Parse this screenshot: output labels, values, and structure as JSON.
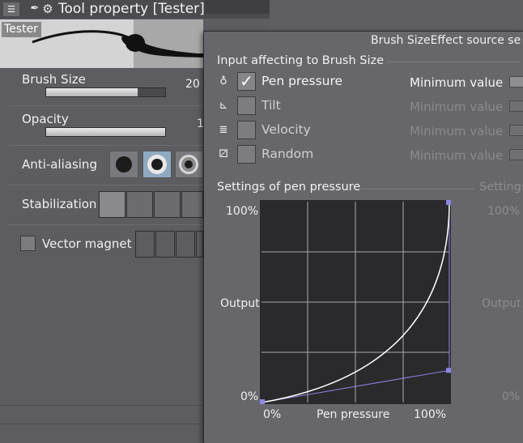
{
  "tool_property": {
    "title": "Tool property [Tester]",
    "menu_icon": "menu-icon",
    "tool_icon": "pen-nib-icon",
    "settings_icon": "gear-icon",
    "preview_label": "Tester",
    "brush_size": {
      "label": "Brush Size",
      "value": "20",
      "fill_fraction": 0.77
    },
    "opacity": {
      "label": "Opacity",
      "value": "1",
      "fill_fraction": 1.0
    },
    "anti_aliasing": {
      "label": "Anti-aliasing",
      "selected_index": 1
    },
    "stabilization": {
      "label": "Stabilization"
    },
    "vector_magnet": {
      "label": "Vector magnet",
      "checked": false
    }
  },
  "dialog": {
    "title": "Brush SizeEffect source se",
    "input_section_title": "Input affecting to Brush Size",
    "inputs": [
      {
        "icon": "pen-pressure-icon",
        "label": "Pen pressure",
        "checked": true,
        "checkmark": "✓",
        "min_label": "Minimum value"
      },
      {
        "icon": "tilt-icon",
        "label": "Tilt",
        "checked": false,
        "checkmark": "",
        "min_label": "Minimum value"
      },
      {
        "icon": "velocity-icon",
        "label": "Velocity",
        "checked": false,
        "checkmark": "",
        "min_label": "Minimum value"
      },
      {
        "icon": "random-icon",
        "label": "Random",
        "checked": false,
        "checkmark": "",
        "min_label": "Minimum value"
      }
    ],
    "settings_title": "Settings of pen pressure",
    "settings_title_right": "Settings",
    "graph": {
      "y_top": "100%",
      "y_mid": "Output",
      "y_bottom": "0%",
      "x_left": "0%",
      "x_mid": "Pen pressure",
      "x_right": "100%",
      "right_y_top": "100%",
      "right_y_mid": "Output",
      "right_y_bottom": "0%",
      "control_points": [
        [
          0,
          0
        ],
        [
          1,
          0.16
        ],
        [
          1,
          1
        ]
      ],
      "curve_color": "#ffffff",
      "handle_color": "#8d86e8"
    }
  }
}
